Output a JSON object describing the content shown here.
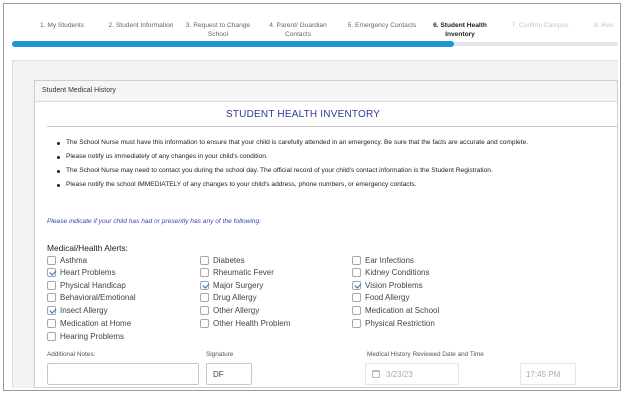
{
  "steps": [
    {
      "label": "1. My Students",
      "state": "done"
    },
    {
      "label": "2. Student Information",
      "state": "done"
    },
    {
      "label": "3. Request to Change School",
      "state": "done"
    },
    {
      "label": "4. Parent/ Guardian Contacts",
      "state": "done"
    },
    {
      "label": "5. Emergency Contacts",
      "state": "done"
    },
    {
      "label": "6. Student Health Inventory",
      "state": "active"
    },
    {
      "label": "7. Confirm Campus",
      "state": "disabled"
    },
    {
      "label": "8. Rev",
      "state": "disabled"
    }
  ],
  "progress": {
    "current_step": 6,
    "color": "#1d96d6"
  },
  "panel": {
    "heading": "Student Medical History",
    "title": "STUDENT HEALTH INVENTORY",
    "notes": [
      "The School Nurse must have this information to ensure that your child is carefully attended in an emergency. Be sure that the facts are accurate and complete.",
      "Please notify us immediately of any changes in your child's condition.",
      "The School Nurse may need to contact you during the school day. The official record of your child's contact information is the Student Registration.",
      "Please notify the school IMMEDIATELY of any changes to your child's address, phone numbers, or emergency contacts."
    ],
    "indicate": "Please indicate if your child has had or presently has any of the following:",
    "alerts_label": "Medical/Health Alerts:",
    "conditions": {
      "col1": [
        {
          "label": "Asthma",
          "checked": false
        },
        {
          "label": "Heart Problems",
          "checked": true
        },
        {
          "label": "Physical Handicap",
          "checked": false
        },
        {
          "label": "Behavioral/Emotional",
          "checked": false
        },
        {
          "label": "Insect Allergy",
          "checked": true
        },
        {
          "label": "Medication at Home",
          "checked": false
        },
        {
          "label": "Hearing Problems",
          "checked": false
        }
      ],
      "col2": [
        {
          "label": "Diabetes",
          "checked": false
        },
        {
          "label": "Rheumatic Fever",
          "checked": false
        },
        {
          "label": "Major Surgery",
          "checked": true
        },
        {
          "label": "Drug Allergy",
          "checked": false
        },
        {
          "label": "Other Allergy",
          "checked": false
        },
        {
          "label": "Other Health Problem",
          "checked": false
        }
      ],
      "col3": [
        {
          "label": "Ear Infections",
          "checked": false
        },
        {
          "label": "Kidney Conditions",
          "checked": false
        },
        {
          "label": "Vision Problems",
          "checked": true
        },
        {
          "label": "Food Allergy",
          "checked": false
        },
        {
          "label": "Medication at School",
          "checked": false
        },
        {
          "label": "Physical Restriction",
          "checked": false
        }
      ]
    },
    "additional_notes_label": "Additional Notes:",
    "additional_notes_value": "",
    "signature_label": "Signature",
    "signature_value": "DF",
    "reviewed_label": "Medical History Reviewed Date and Time",
    "reviewed_date": "3/23/23",
    "reviewed_time": "17:45 PM"
  },
  "colors": {
    "accent": "#1d96d6",
    "title": "#2b3a9b",
    "check": "#2d6fb8"
  }
}
